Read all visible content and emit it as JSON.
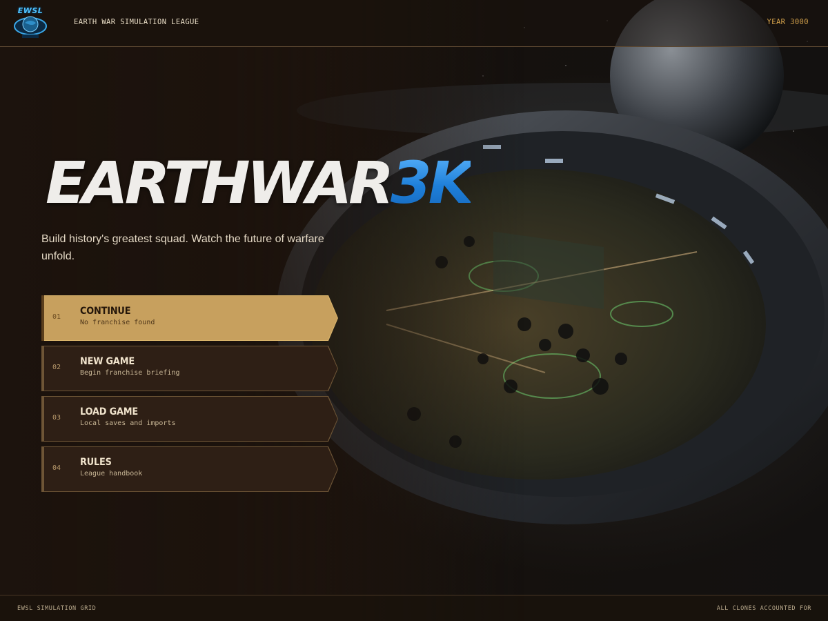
{
  "header": {
    "logo_text": "EWSL",
    "league_name": "EARTH WAR SIMULATION LEAGUE",
    "year": "YEAR 3000"
  },
  "hero": {
    "title_main": "EARTHWAR",
    "title_accent": "3K",
    "tagline": "Build history's greatest squad. Watch the future of warfare unfold."
  },
  "menu": {
    "items": [
      {
        "number": "01",
        "title": "CONTINUE",
        "subtitle": "No franchise found",
        "active": true
      },
      {
        "number": "02",
        "title": "NEW GAME",
        "subtitle": "Begin franchise briefing",
        "active": false
      },
      {
        "number": "03",
        "title": "LOAD GAME",
        "subtitle": "Local saves and imports",
        "active": false
      },
      {
        "number": "04",
        "title": "RULES",
        "subtitle": "League handbook",
        "active": false
      }
    ]
  },
  "footer": {
    "left": "EWSL SIMULATION GRID",
    "right": "ALL CLONES ACCOUNTED FOR"
  },
  "colors": {
    "background": "#1a120c",
    "gold_accent": "#c7a05e",
    "year_text": "#d4a24c",
    "title_blue": "#2b8fe6",
    "logo_blue": "#4fc3ff"
  },
  "icons": {
    "logo": "ewsl-emblem-icon"
  }
}
